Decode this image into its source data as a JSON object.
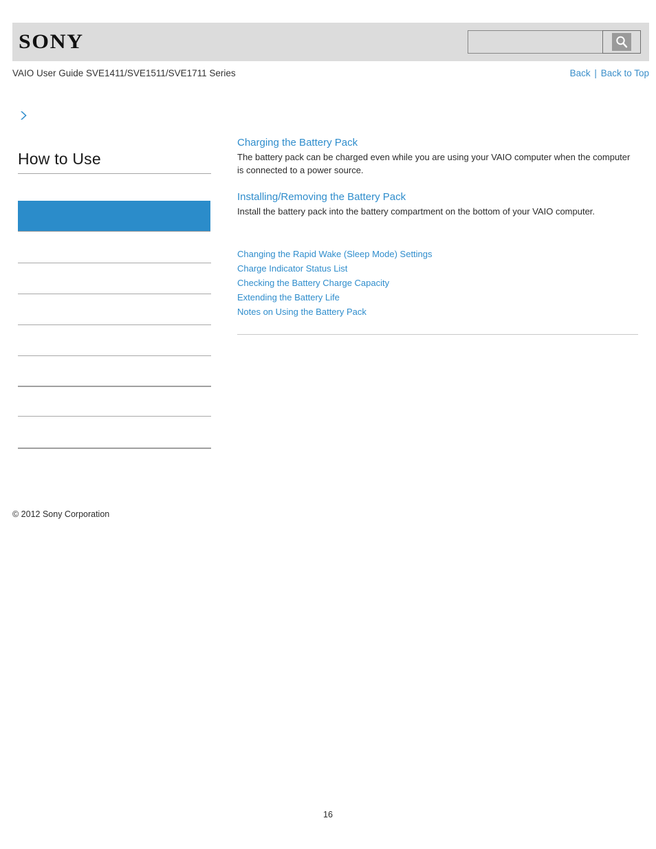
{
  "header": {
    "logo_text": "SONY",
    "logo_icon": "sony-wordmark",
    "search": {
      "value": "",
      "placeholder": "",
      "button_icon": "search-icon"
    },
    "band_color": "#dcdcdc"
  },
  "subheader": {
    "guide_title": "VAIO User Guide SVE1411/SVE1511/SVE1711 Series",
    "nav": {
      "back_label": "Back",
      "separator": "|",
      "back_to_top_label": "Back to Top"
    }
  },
  "sidebar": {
    "expand_icon": "chevron-right-icon",
    "section_title": "How to Use",
    "selected_item": {
      "label": "",
      "highlight_color": "#2b8cca"
    },
    "items": [
      {
        "label": ""
      },
      {
        "label": ""
      },
      {
        "label": ""
      },
      {
        "label": ""
      },
      {
        "label": ""
      },
      {
        "label": ""
      },
      {
        "label": ""
      }
    ],
    "copyright": "© 2012 Sony Corporation"
  },
  "main": {
    "topics": [
      {
        "title": "Charging the Battery Pack",
        "description": "The battery pack can be charged even while you are using your VAIO computer when the computer is connected to a power source."
      },
      {
        "title": "Installing/Removing the Battery Pack",
        "description": "Install the battery pack into the battery compartment on the bottom of your VAIO computer."
      }
    ],
    "related_links": [
      "Changing the Rapid Wake (Sleep Mode) Settings",
      "Charge Indicator Status List",
      "Checking the Battery Charge Capacity",
      "Extending the Battery Life",
      "Notes on Using the Battery Pack"
    ]
  },
  "footer": {
    "page_number": "16"
  },
  "colors": {
    "link": "#2f8dcc",
    "accent": "#2b8cca",
    "header_band": "#dcdcdc",
    "rule": "#c9c9c9",
    "text": "#2b2b2b"
  }
}
